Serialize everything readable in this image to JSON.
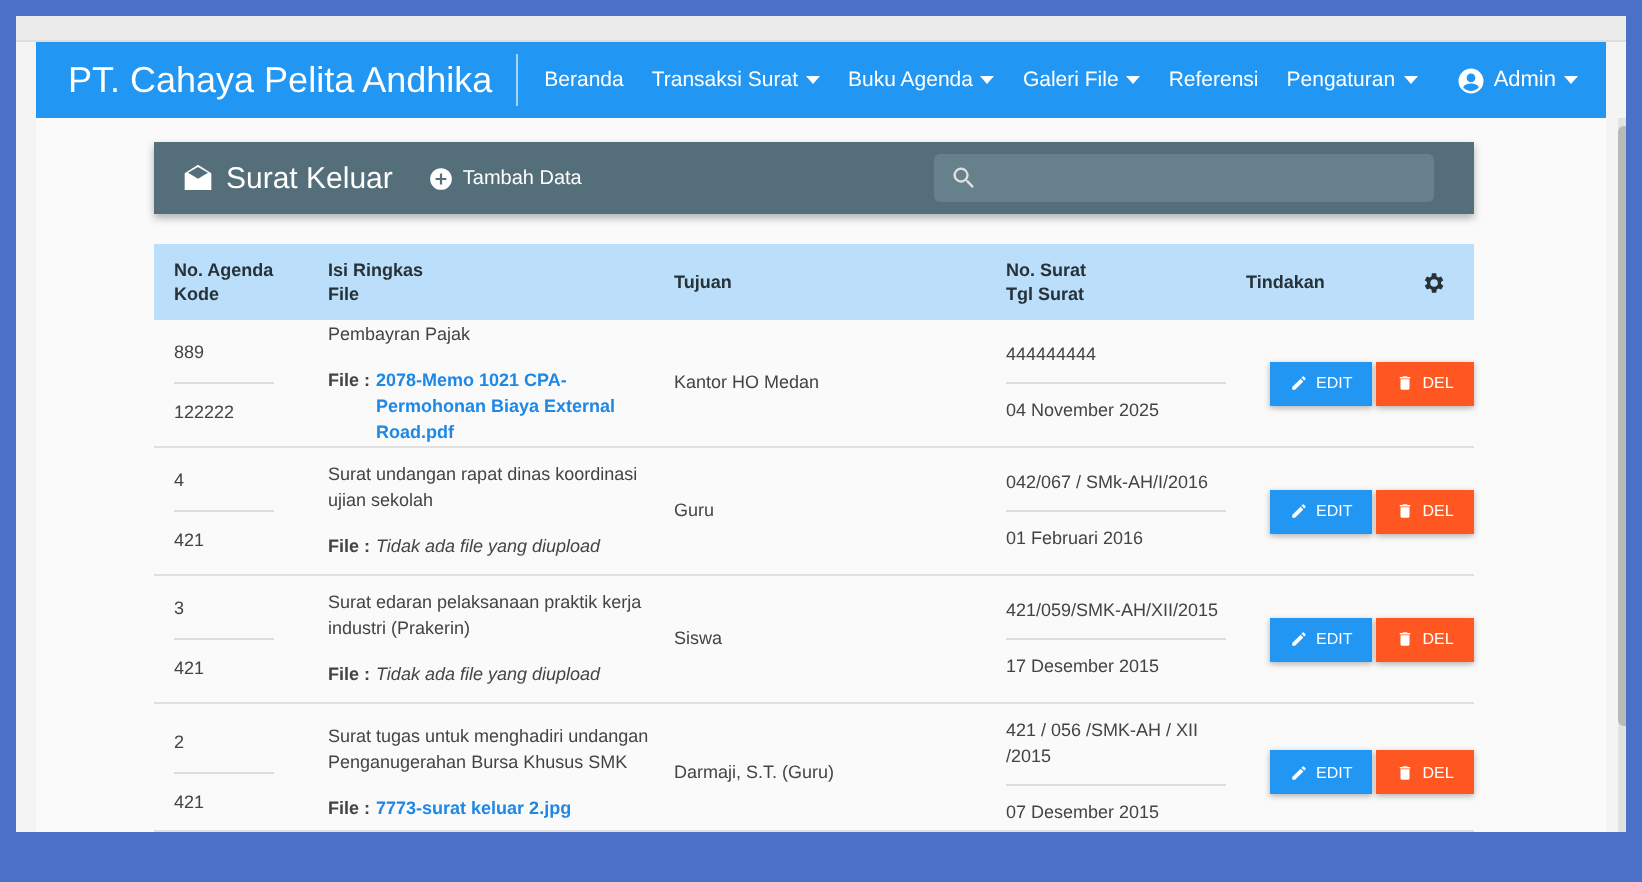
{
  "navbar": {
    "brand": "PT. Cahaya Pelita Andhika",
    "menu": [
      {
        "label": "Beranda",
        "dropdown": false
      },
      {
        "label": "Transaksi Surat",
        "dropdown": true
      },
      {
        "label": "Buku Agenda",
        "dropdown": true
      },
      {
        "label": "Galeri File",
        "dropdown": true
      },
      {
        "label": "Referensi",
        "dropdown": false
      },
      {
        "label": "Pengaturan",
        "dropdown": true
      }
    ],
    "user": "Admin"
  },
  "panel": {
    "title": "Surat Keluar",
    "add_label": "Tambah Data"
  },
  "table": {
    "columns": [
      [
        "No. Agenda",
        "Kode"
      ],
      [
        "Isi Ringkas",
        "File"
      ],
      [
        "Tujuan"
      ],
      [
        "No. Surat",
        "Tgl Surat"
      ],
      [
        "Tindakan"
      ]
    ],
    "rows": [
      {
        "agenda": "889",
        "kode": "122222",
        "isi": "Pembayran Pajak",
        "file_label": "File :",
        "file": {
          "kind": "link",
          "text": "2078-Memo 1021 CPA-Permohonan Biaya External Road.pdf"
        },
        "tujuan": "Kantor HO Medan",
        "no_surat": "444444444",
        "tgl": "04 November 2025",
        "edit": "EDIT",
        "del": "DEL"
      },
      {
        "agenda": "4",
        "kode": "421",
        "isi": "Surat undangan rapat dinas koordinasi ujian sekolah",
        "file_label": "File :",
        "file": {
          "kind": "none",
          "text": "Tidak ada file yang diupload"
        },
        "tujuan": "Guru",
        "no_surat": "042/067 / SMk-AH/I/2016",
        "tgl": "01 Februari 2016",
        "edit": "EDIT",
        "del": "DEL"
      },
      {
        "agenda": "3",
        "kode": "421",
        "isi": "Surat edaran pelaksanaan praktik kerja industri (Prakerin)",
        "file_label": "File :",
        "file": {
          "kind": "none",
          "text": "Tidak ada file yang diupload"
        },
        "tujuan": "Siswa",
        "no_surat": "421/059/SMK-AH/XII/2015",
        "tgl": "17 Desember 2015",
        "edit": "EDIT",
        "del": "DEL"
      },
      {
        "agenda": "2",
        "kode": "421",
        "isi": "Surat tugas untuk menghadiri undangan Penganugerahan Bursa Khusus SMK",
        "file_label": "File :",
        "file": {
          "kind": "link",
          "text": "7773-surat keluar 2.jpg"
        },
        "tujuan": "Darmaji, S.T. (Guru)",
        "no_surat": "421 / 056 /SMK-AH / XII /2015",
        "tgl": "07 Desember 2015",
        "edit": "EDIT",
        "del": "DEL"
      }
    ]
  }
}
